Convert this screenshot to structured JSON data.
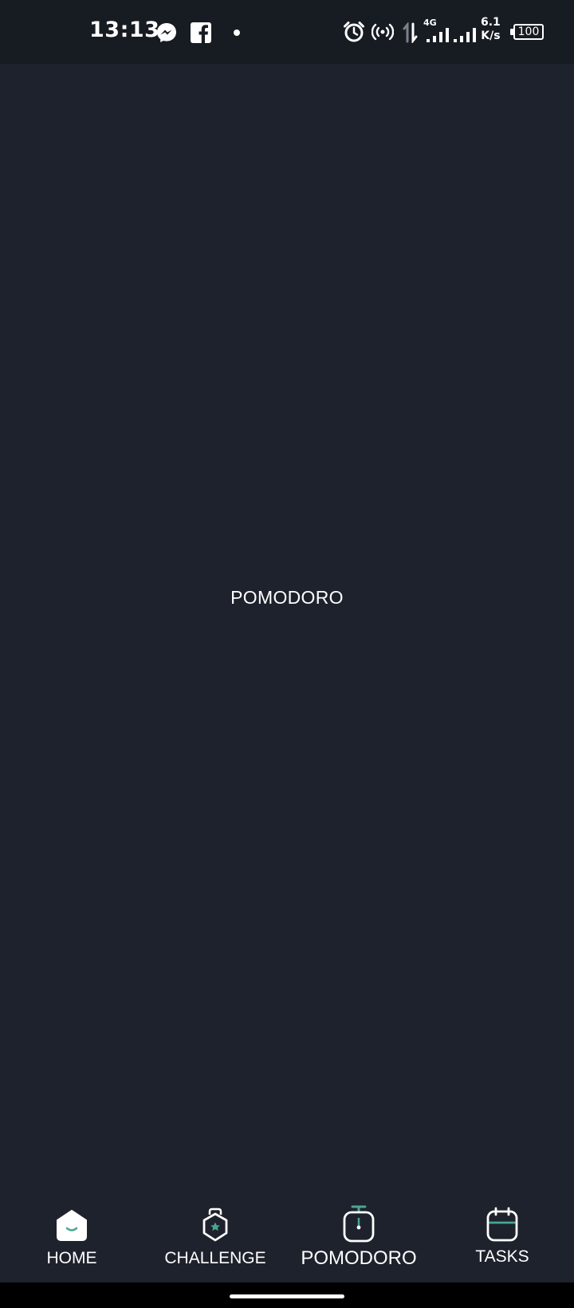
{
  "status_bar": {
    "time": "13:13",
    "network_type": "4G",
    "net_speed_value": "6.1",
    "net_speed_unit": "K/s",
    "battery_level": "100",
    "icons": [
      "messenger-icon",
      "facebook-icon",
      "notification-dot-icon",
      "alarm-icon",
      "hotspot-icon",
      "data-transfer-icon",
      "signal-icon",
      "signal-icon-2",
      "battery-icon"
    ]
  },
  "main": {
    "title": "POMODORO"
  },
  "bottom_nav": {
    "accent_color": "#4aa690",
    "items": [
      {
        "label": "HOME",
        "icon": "home-icon"
      },
      {
        "label": "CHALLENGE",
        "icon": "challenge-icon"
      },
      {
        "label": "POMODORO",
        "icon": "timer-icon",
        "active": true
      },
      {
        "label": "TASKS",
        "icon": "calendar-icon"
      }
    ]
  }
}
